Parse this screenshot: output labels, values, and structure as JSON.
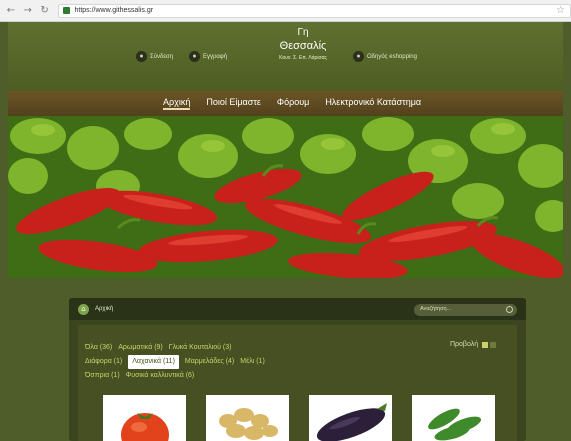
{
  "browser": {
    "url": "https://www.githessalis.gr"
  },
  "header": {
    "login_label": "Σύνδεση",
    "register_label": "Εγγραφή",
    "site_title_line1": "Γη",
    "site_title_line2": "Θεσσαλίς",
    "site_subtitle": "Κουν. Σ. Επ. Λάρισας",
    "guide_label": "Οδηγός eshopping"
  },
  "nav": {
    "items": [
      {
        "label": "Αρχική"
      },
      {
        "label": "Ποιοί Είμαστε"
      },
      {
        "label": "Φόρουμ"
      },
      {
        "label": "Ηλεκτρονικό Κατάστημα"
      }
    ]
  },
  "panel": {
    "breadcrumb": "Αρχική",
    "search_placeholder": "Αναζήτηση...",
    "view_label": "Προβολή",
    "filters_row1": [
      {
        "label": "Όλα (36)"
      },
      {
        "label": "Αρωματικά (9)"
      },
      {
        "label": "Γλυκά Κουταλιού (3)"
      }
    ],
    "filters_row2": [
      {
        "label": "Διάφορα (1)"
      },
      {
        "label": "Λαχανικά (11)"
      },
      {
        "label": "Μαρμελάδες (4)"
      },
      {
        "label": "Μέλι (1)"
      }
    ],
    "filters_row3": [
      {
        "label": "Όσπρια (1)"
      },
      {
        "label": "Φυσικά καλλυντικά (6)"
      }
    ]
  },
  "products": [
    {
      "icon": "tomato-icon"
    },
    {
      "icon": "potatoes-icon"
    },
    {
      "icon": "eggplant-icon"
    },
    {
      "icon": "cucumbers-icon"
    }
  ]
}
